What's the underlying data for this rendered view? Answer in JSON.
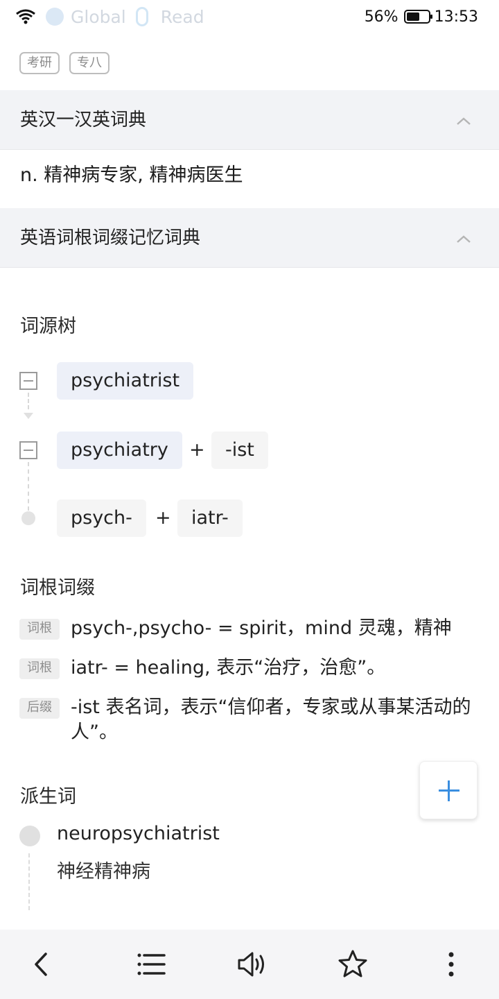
{
  "status_bar": {
    "notif_1": "Global",
    "notif_2": "Read",
    "battery_percent": "56%",
    "time": "13:53"
  },
  "tags": [
    "考研",
    "专八"
  ],
  "sections": [
    {
      "title": "英汉一汉英词典",
      "chevron": "chevron-up-icon"
    },
    {
      "title": "英语词根词缀记忆词典",
      "chevron": "chevron-up-icon"
    }
  ],
  "definition": "n. 精神病专家, 精神病医生",
  "etymology": {
    "heading": "词源树",
    "level1": {
      "word": "psychiatrist"
    },
    "level2": {
      "left": "psychiatry",
      "plus": "+",
      "right": "-ist"
    },
    "level3": {
      "left": "psych-",
      "plus": "+",
      "right": "iatr-"
    }
  },
  "affixes": {
    "heading": "词根词缀",
    "rows": [
      {
        "label": "词根",
        "text": "psych-,psycho- = spirit，mind 灵魂，精神"
      },
      {
        "label": "词根",
        "text": "iatr- = healing, 表示“治疗，治愈”。"
      },
      {
        "label": "后缀",
        "text": "-ist 表名词，表示“信仰者，专家或从事某活动的人”。"
      }
    ]
  },
  "derived": {
    "heading": "派生词",
    "items": [
      {
        "word": "neuropsychiatrist",
        "meaning": "神经精神病"
      }
    ]
  },
  "colors": {
    "accent": "#3a8ee0",
    "header_bg": "#f2f3f6",
    "chip_root_bg": "#edf0f8"
  },
  "bottom_bar": [
    "back-icon",
    "list-icon",
    "speaker-icon",
    "star-icon",
    "more-icon"
  ]
}
